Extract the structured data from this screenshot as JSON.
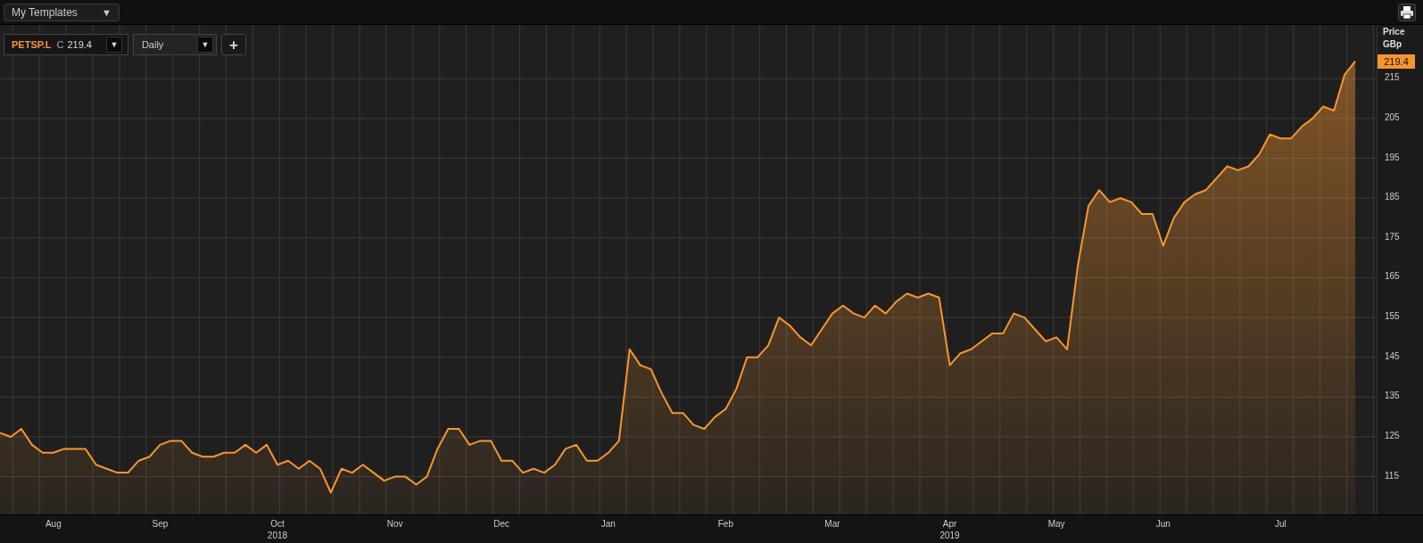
{
  "toolbar": {
    "template_select": {
      "value": "My Templates",
      "arrow": "▼"
    }
  },
  "legend": {
    "close_label": "C",
    "close_value": "219.4",
    "arrow": "▼",
    "interval": "Daily",
    "interval_arrow": "▼",
    "add_button": "+"
  },
  "price_axis": {
    "title": "Price",
    "unit": "GBp",
    "last_price": "219.4"
  },
  "x_axis_years": [
    "2018",
    "2019"
  ],
  "chart_data": {
    "type": "area",
    "grid": true,
    "ylim": [
      105.5,
      228.5
    ],
    "yticks": [
      115,
      125,
      135,
      145,
      155,
      165,
      175,
      185,
      195,
      205,
      215
    ],
    "categories": [
      null,
      null,
      null,
      null,
      null,
      "Aug",
      null,
      null,
      null,
      null,
      null,
      null,
      null,
      null,
      null,
      "Sep",
      null,
      null,
      null,
      null,
      null,
      null,
      null,
      null,
      null,
      null,
      "Oct",
      null,
      null,
      null,
      null,
      null,
      null,
      null,
      null,
      null,
      null,
      "Nov",
      null,
      null,
      null,
      null,
      null,
      null,
      null,
      null,
      null,
      "Dec",
      null,
      null,
      null,
      null,
      null,
      null,
      null,
      null,
      null,
      "Jan",
      null,
      null,
      null,
      null,
      null,
      null,
      null,
      null,
      null,
      null,
      "Feb",
      null,
      null,
      null,
      null,
      null,
      null,
      null,
      null,
      null,
      "Mar",
      null,
      null,
      null,
      null,
      null,
      null,
      null,
      null,
      null,
      null,
      "Apr",
      null,
      null,
      null,
      null,
      null,
      null,
      null,
      null,
      null,
      "May",
      null,
      null,
      null,
      null,
      null,
      null,
      null,
      null,
      null,
      "Jun",
      null,
      null,
      null,
      null,
      null,
      null,
      null,
      null,
      null,
      null,
      "Jul",
      null,
      null,
      null,
      null,
      null,
      null,
      null
    ],
    "series": [
      {
        "name": "PETSP.L",
        "color": "#f7962f",
        "values": [
          126,
          125,
          127,
          123,
          121,
          121,
          122,
          122,
          122,
          118,
          117,
          116,
          116,
          119,
          120,
          123,
          124,
          124,
          121,
          120,
          120,
          121,
          121,
          123,
          121,
          123,
          118,
          119,
          117,
          119,
          117,
          111,
          117,
          116,
          118,
          116,
          114,
          115,
          115,
          113,
          115,
          122,
          127,
          127,
          123,
          124,
          124,
          119,
          119,
          116,
          117,
          116,
          118,
          122,
          123,
          119,
          119,
          121,
          124,
          147,
          143,
          142,
          136,
          131,
          131,
          128,
          127,
          130,
          132,
          137,
          145,
          145,
          148,
          155,
          153,
          150,
          148,
          152,
          156,
          158,
          156,
          155,
          158,
          156,
          159,
          161,
          160,
          161,
          160,
          143,
          146,
          147,
          149,
          151,
          151,
          156,
          155,
          152,
          149,
          150,
          147,
          168,
          183,
          187,
          184,
          185,
          184,
          181,
          181,
          173,
          180,
          184,
          186,
          187,
          190,
          193,
          192,
          193,
          196,
          201,
          200,
          200,
          203,
          205,
          208,
          207,
          216,
          219.4
        ]
      }
    ]
  }
}
